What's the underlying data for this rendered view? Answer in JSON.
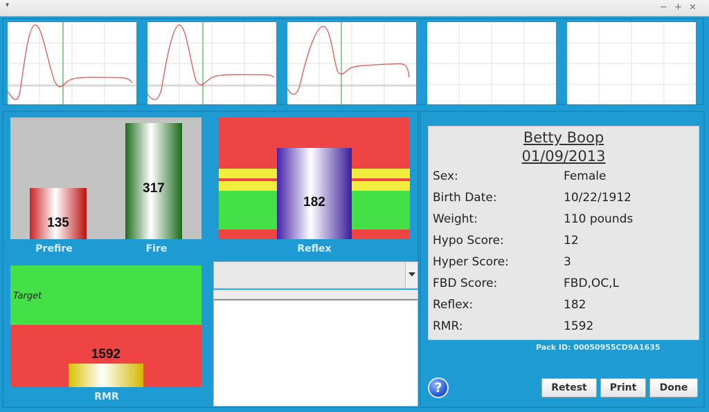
{
  "window": {
    "controls": {
      "menu": "▾",
      "minimize": "−",
      "maximize": "+",
      "close": "×"
    }
  },
  "colors": {
    "background": "#1e9bd3",
    "red": "#ef4444",
    "green": "#45e048",
    "yellow": "#f2ec3a"
  },
  "waveforms": [
    {
      "has_signal": true
    },
    {
      "has_signal": true
    },
    {
      "has_signal": true
    },
    {
      "has_signal": false
    },
    {
      "has_signal": false
    }
  ],
  "gauges": {
    "prefire": {
      "label": "Prefire",
      "value": "135",
      "level": 135
    },
    "fire": {
      "label": "Fire",
      "value": "317",
      "level": 317
    },
    "reflex": {
      "label": "Reflex",
      "value": "182"
    },
    "rmr": {
      "label": "RMR",
      "value": "1592",
      "target_label": "Target"
    }
  },
  "dropdown": {
    "selected": ""
  },
  "patient": {
    "name": "Betty Boop",
    "date": "01/09/2013",
    "rows": [
      {
        "key": "Sex:",
        "value": "Female"
      },
      {
        "key": "Birth Date:",
        "value": "10/22/1912"
      },
      {
        "key": "Weight:",
        "value": "110 pounds"
      },
      {
        "key": "Hypo Score:",
        "value": "12"
      },
      {
        "key": "Hyper Score:",
        "value": "3"
      },
      {
        "key": "FBD Score:",
        "value": "FBD,OC,L"
      },
      {
        "key": "Reflex:",
        "value": "182"
      },
      {
        "key": "RMR:",
        "value": "1592"
      }
    ]
  },
  "pack_id": "Pack ID: 00050955CD9A1635",
  "buttons": {
    "help": "?",
    "retest": "Retest",
    "print": "Print",
    "done": "Done"
  }
}
